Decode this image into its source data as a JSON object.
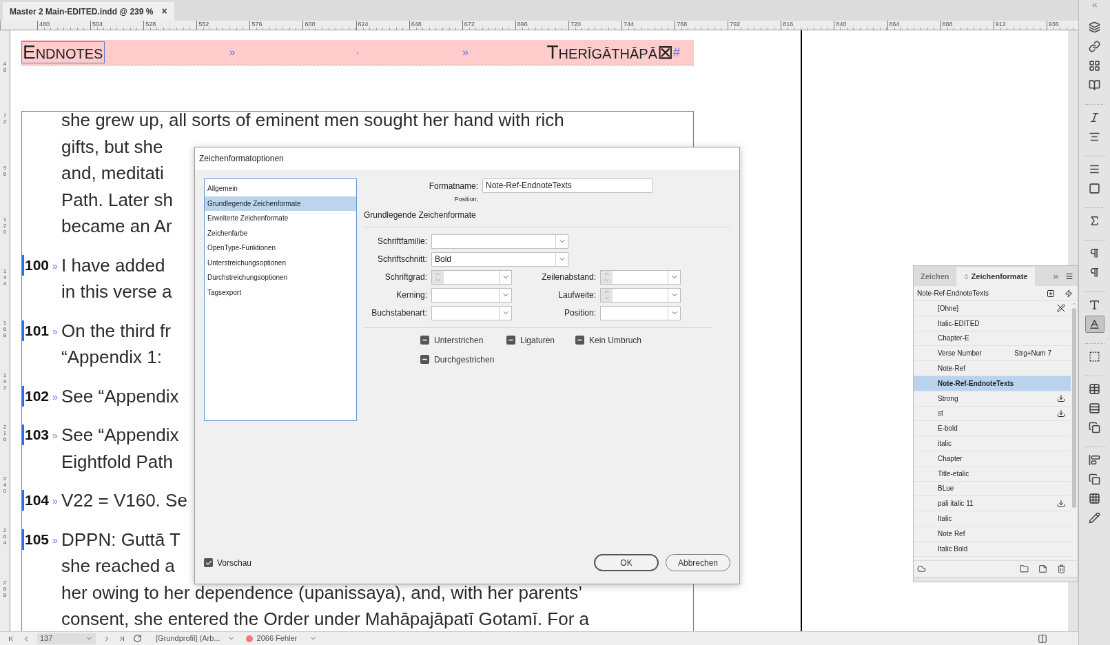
{
  "document_tab": {
    "title": "Master 2 Main-EDITED.indd @ 239 %",
    "close": "×"
  },
  "ruler": {
    "horizontal": [
      "480",
      "504",
      "528",
      "552",
      "576",
      "600",
      "624",
      "648",
      "672",
      "696",
      "720",
      "744",
      "768",
      "792",
      "816",
      "840",
      "864",
      "888",
      "912",
      "936"
    ],
    "vertical": [
      "48",
      "72",
      "96",
      "120",
      "144",
      "168",
      "192",
      "216",
      "240",
      "264",
      "288"
    ]
  },
  "header": {
    "left": "Endnotes",
    "markers": [
      "»",
      "·",
      "»"
    ],
    "right": "Therīgāthāpā⊠",
    "end_mark": "#"
  },
  "paragraphs": [
    {
      "lines": [
        "she grew up, all sorts of eminent men sought her hand with rich",
        "gifts, but she",
        "and, meditati",
        "Path. Later sh",
        "became an Ar"
      ]
    },
    {
      "number": "100",
      "marker": "»",
      "lines": [
        "I have added",
        "in this verse a"
      ]
    },
    {
      "number": "101",
      "marker": "»",
      "lines": [
        "On the third fr",
        "“Appendix 1:"
      ]
    },
    {
      "number": "102",
      "marker": "»",
      "lines": [
        "See “Appendix"
      ]
    },
    {
      "number": "103",
      "marker": "»",
      "lines": [
        "See “Appendix",
        "Eightfold Path"
      ]
    },
    {
      "number": "104",
      "marker": "»",
      "lines": [
        "V22 = V160. Se"
      ]
    },
    {
      "number": "105",
      "marker": "»",
      "lines": [
        "DPPN: Guttā T",
        "she reached a",
        "her owing to her dependence (upanissaya), and, with her parents’",
        "consent, she entered the Order under Mahāpajāpatī Gotamī. For a"
      ]
    }
  ],
  "dialog": {
    "title": "Zeichenformatoptionen",
    "sections": [
      {
        "label": "Allgemein",
        "selected": false
      },
      {
        "label": "Grundlegende Zeichenformate",
        "selected": true
      },
      {
        "label": "Erweiterte Zeichenformate",
        "selected": false
      },
      {
        "label": "Zeichenfarbe",
        "selected": false
      },
      {
        "label": "OpenType-Funktionen",
        "selected": false
      },
      {
        "label": "Unterstreichungsoptionen",
        "selected": false
      },
      {
        "label": "Durchstreichungsoptionen",
        "selected": false
      },
      {
        "label": "Tagsexport",
        "selected": false
      }
    ],
    "name_label": "Formatname:",
    "name_value": "Note-Ref-EndnoteTexts",
    "position_label": "Position:",
    "heading": "Grundlegende Zeichenformate",
    "rows": [
      {
        "fields": [
          {
            "label": "Schriftfamilie:",
            "kind": "dropdown"
          }
        ]
      },
      {
        "fields": [
          {
            "label": "Schriftschnitt:",
            "kind": "dropdown",
            "value": "Bold"
          }
        ]
      },
      {
        "fields": [
          {
            "label": "Schriftgrad:",
            "kind": "spin"
          },
          {
            "label": "Zeilenabstand:",
            "kind": "spin"
          }
        ]
      },
      {
        "fields": [
          {
            "label": "Kerning:",
            "kind": "dropdown"
          },
          {
            "label": "Laufweite:",
            "kind": "spin"
          }
        ]
      },
      {
        "fields": [
          {
            "label": "Buchstabenart:",
            "kind": "dropdown"
          },
          {
            "label": "Position:",
            "kind": "dropdown"
          }
        ]
      }
    ],
    "checkboxes": [
      {
        "label": "Unterstrichen",
        "mixed": true
      },
      {
        "label": "Ligaturen",
        "mixed": true
      },
      {
        "label": "Kein Umbruch",
        "mixed": true
      },
      {
        "label": "Durchgestrichen",
        "mixed": true
      }
    ],
    "preview": {
      "label": "Vorschau",
      "checked": true
    },
    "buttons": [
      {
        "label": "OK",
        "default": true
      },
      {
        "label": "Abbrechen",
        "default": false
      }
    ]
  },
  "styles_panel": {
    "tabs": [
      {
        "label": "Zeichen",
        "selected": false
      },
      {
        "label": "Zeichenformate",
        "selected": true
      }
    ],
    "current": "Note-Ref-EndnoteTexts",
    "items": [
      {
        "label": "[Ohne]",
        "kind": "base",
        "selected": false
      },
      {
        "label": "Italic-EDITED",
        "kind": "plain",
        "selected": false
      },
      {
        "label": "Chapter-E",
        "kind": "plain",
        "selected": false
      },
      {
        "label": "Verse Number",
        "kind": "plain",
        "shortcut": "Strg+Num 7",
        "selected": false
      },
      {
        "label": "Note-Ref",
        "kind": "plain",
        "selected": false
      },
      {
        "label": "Note-Ref-EndnoteTexts",
        "kind": "plain",
        "selected": true
      },
      {
        "label": "Strong",
        "kind": "imported",
        "selected": false
      },
      {
        "label": "st",
        "kind": "imported",
        "selected": false
      },
      {
        "label": "E-bold",
        "kind": "plain",
        "selected": false
      },
      {
        "label": "italic",
        "kind": "plain",
        "selected": false
      },
      {
        "label": "Chapter",
        "kind": "plain",
        "selected": false
      },
      {
        "label": "Title-etalic",
        "kind": "plain",
        "selected": false
      },
      {
        "label": "BLue",
        "kind": "plain",
        "selected": false
      },
      {
        "label": "pali italic 11",
        "kind": "imported",
        "selected": false
      },
      {
        "label": "Italic",
        "kind": "plain",
        "selected": false
      },
      {
        "label": "Note Ref",
        "kind": "plain",
        "selected": false
      },
      {
        "label": "Italic Bold",
        "kind": "plain",
        "selected": false
      }
    ]
  },
  "toolbar": [
    {
      "kind": "layers",
      "selected": false
    },
    {
      "kind": "links",
      "selected": false
    },
    {
      "kind": "swatches",
      "selected": false
    },
    {
      "kind": "pages",
      "selected": false
    },
    {
      "kind": "glyphs",
      "selected": false
    },
    {
      "kind": "align-text",
      "selected": false
    },
    {
      "kind": "stroke",
      "selected": false
    },
    {
      "kind": "gradient",
      "selected": false
    },
    {
      "kind": "effects",
      "selected": false
    },
    {
      "kind": "paragraph-styles",
      "selected": false
    },
    {
      "kind": "paragraph",
      "selected": false
    },
    {
      "kind": "character",
      "selected": false
    },
    {
      "kind": "character-styles",
      "selected": true
    },
    {
      "kind": "object-styles",
      "selected": false
    },
    {
      "kind": "table",
      "selected": false
    },
    {
      "kind": "table-styles",
      "selected": false
    },
    {
      "kind": "cell-styles",
      "selected": false
    },
    {
      "kind": "align",
      "selected": false
    },
    {
      "kind": "pathfinder",
      "selected": false
    },
    {
      "kind": "transform",
      "selected": false
    },
    {
      "kind": "preflight",
      "selected": false
    }
  ],
  "status_bar": {
    "page": "137",
    "profile": "[Grundprofil] (Arb...",
    "errors": "2066 Fehler"
  }
}
